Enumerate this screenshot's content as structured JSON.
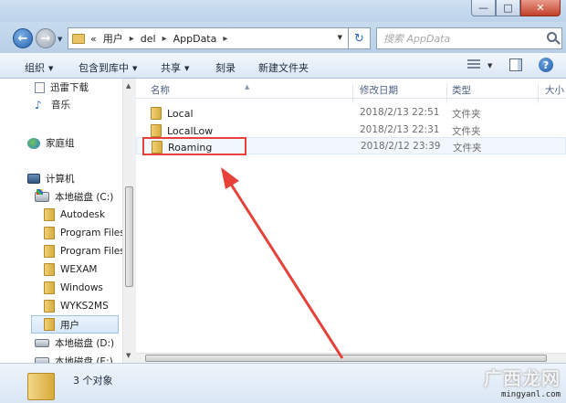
{
  "window": {
    "buttons": {
      "minimize": "—",
      "maximize": "□",
      "close": "✕"
    }
  },
  "address": {
    "overflow": "«",
    "crumbs": [
      "用户",
      "del",
      "AppData"
    ],
    "separator": "▸",
    "search_placeholder": "搜索 AppData"
  },
  "toolbar": {
    "organize": "组织",
    "include_in_library": "包含到库中",
    "share": "共享",
    "burn": "刻录",
    "new_folder": "新建文件夹",
    "help": "?"
  },
  "nav": {
    "items": [
      {
        "label": "迅雷下载",
        "icon": "document-icon"
      },
      {
        "label": "音乐",
        "icon": "music-icon"
      },
      {
        "label": "家庭组",
        "icon": "homegroup-icon"
      },
      {
        "label": "计算机",
        "icon": "computer-icon"
      },
      {
        "label": "本地磁盘 (C:)",
        "icon": "drive-c-icon"
      },
      {
        "label": "Autodesk",
        "icon": "folder-icon"
      },
      {
        "label": "Program Files",
        "icon": "folder-icon"
      },
      {
        "label": "Program Files",
        "icon": "folder-icon"
      },
      {
        "label": "WEXAM",
        "icon": "folder-icon"
      },
      {
        "label": "Windows",
        "icon": "folder-icon"
      },
      {
        "label": "WYKS2MS",
        "icon": "folder-icon"
      },
      {
        "label": "用户",
        "icon": "folder-icon",
        "selected": true
      },
      {
        "label": "本地磁盘 (D:)",
        "icon": "drive-icon"
      },
      {
        "label": "本地磁盘 (E:)",
        "icon": "drive-icon"
      }
    ]
  },
  "columns": {
    "name": "名称",
    "date": "修改日期",
    "type": "类型",
    "size": "大小"
  },
  "files": [
    {
      "name": "Local",
      "date": "2018/2/13 22:51",
      "type": "文件夹"
    },
    {
      "name": "LocalLow",
      "date": "2018/2/13 22:31",
      "type": "文件夹"
    },
    {
      "name": "Roaming",
      "date": "2018/2/12 23:39",
      "type": "文件夹"
    }
  ],
  "status": {
    "count": "3 个对象"
  },
  "watermark": {
    "brand": "广西龙网",
    "url": "mingyanl.com"
  },
  "colors": {
    "annotation_red": "#e8413a",
    "accent_blue": "#2563b0"
  }
}
